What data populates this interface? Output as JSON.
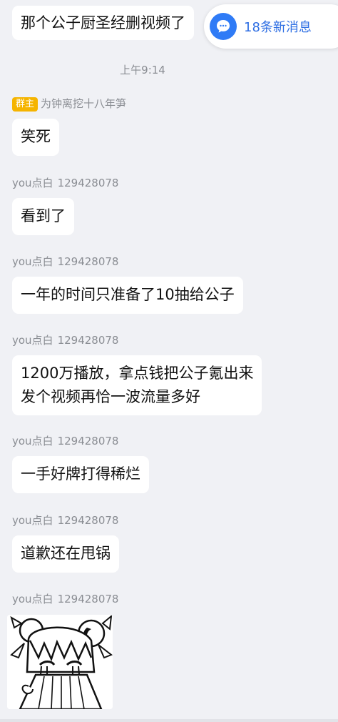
{
  "messages": {
    "top": "那个公子厨圣经删视频了",
    "m1": "笑死",
    "m2": "看到了",
    "m3": "一年的时间只准备了10抽给公子",
    "m4_line1": "1200万播放，拿点钱把公子氪出来",
    "m4_line2": "发个视频再恰一波流量多好",
    "m5": "一手好牌打得稀烂",
    "m6": "道歉还在甩锅"
  },
  "timestamp": "上午9:14",
  "senders": {
    "owner_badge": "群主",
    "owner_name": "为钟离挖十八年笋",
    "user_name": "you点白",
    "user_id": "129428078"
  },
  "new_messages": {
    "label": "18条新消息",
    "icon": "chat-bubble-icon",
    "accent": "#2f7bf6"
  },
  "colors": {
    "background": "#f0f1f5",
    "bubble": "#ffffff",
    "badge": "#f5b400"
  }
}
